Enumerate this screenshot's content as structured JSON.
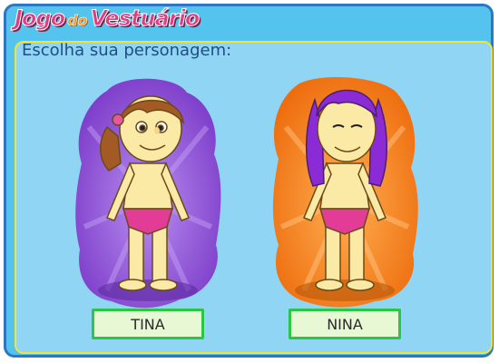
{
  "header": {
    "title_word1": "Jogo",
    "title_word2": "do",
    "title_word3": "Vestuário"
  },
  "instruction": "Escolha sua personagem:",
  "characters": [
    {
      "name": "TINA",
      "background_color": "#8d4fd6",
      "hair_color": "#a35a24"
    },
    {
      "name": "NINA",
      "background_color": "#f57c19",
      "hair_color": "#8b2bd6"
    }
  ],
  "colors": {
    "frame": "#54c3ee",
    "panel": "#90d5f4",
    "title": "#dd3d82",
    "name_border": "#2cc545"
  }
}
